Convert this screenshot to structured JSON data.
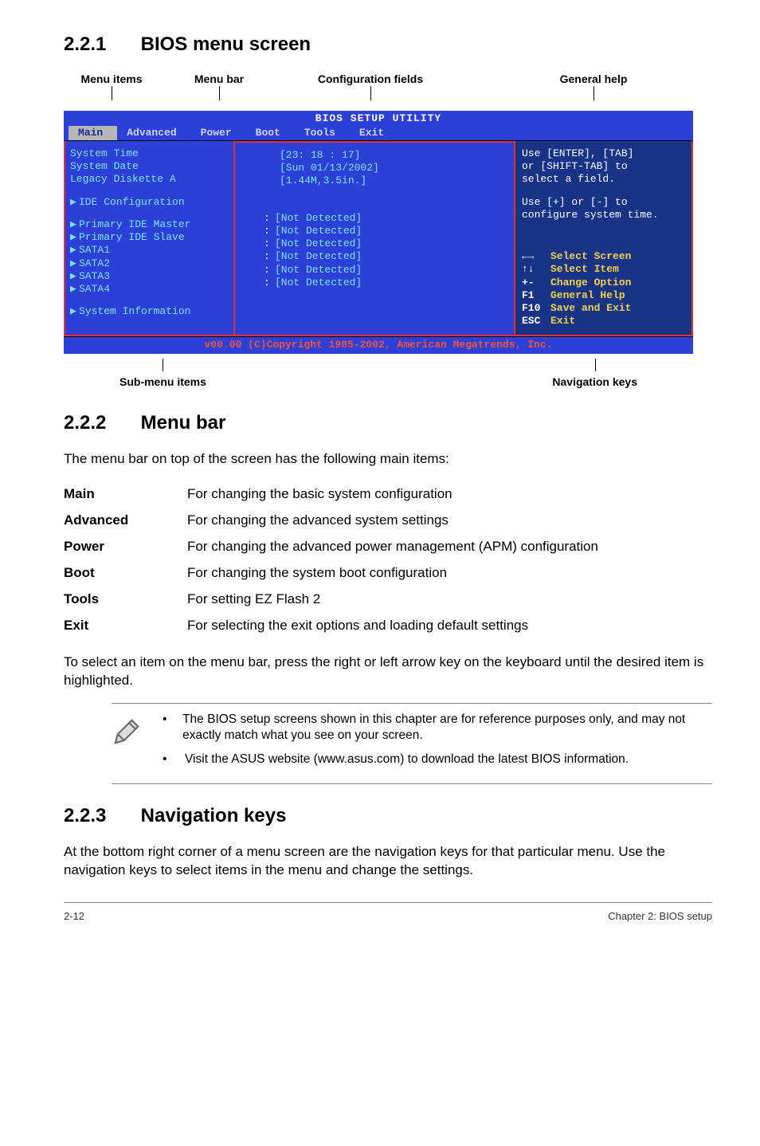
{
  "sections": {
    "s1": {
      "num": "2.2.1",
      "title": "BIOS menu screen"
    },
    "s2": {
      "num": "2.2.2",
      "title": "Menu bar"
    },
    "s3": {
      "num": "2.2.3",
      "title": "Navigation keys"
    }
  },
  "topLabels": {
    "menuItems": "Menu items",
    "menuBar": "Menu bar",
    "configFields": "Configuration fields",
    "generalHelp": "General help"
  },
  "bios": {
    "utilTitle": "BIOS SETUP UTILITY",
    "tabs": [
      "Main",
      "Advanced",
      "Power",
      "Boot",
      "Tools",
      "Exit"
    ],
    "left": {
      "sysTime": "System Time",
      "sysDate": "System Date",
      "legacy": "Legacy Diskette A",
      "ideConf": "IDE Configuration",
      "pMaster": "Primary IDE Master",
      "pSlave": "Primary IDE Slave",
      "sata1": "SATA1",
      "sata2": "SATA2",
      "sata3": "SATA3",
      "sata4": "SATA4",
      "sysInfo": "System Information"
    },
    "mid": {
      "time": "[23: 18 : 17]",
      "date": "[Sun 01/13/2002]",
      "disk": "[1.44M,3.5in.]",
      "nd": "[Not Detected]"
    },
    "right": {
      "hint1a": "Use [ENTER], [TAB]",
      "hint1b": "or [SHIFT-TAB] to",
      "hint1c": "select a field.",
      "hint2a": "Use [+] or [-] to",
      "hint2b": "configure system time.",
      "nav": [
        {
          "k": "←→",
          "d": "Select Screen"
        },
        {
          "k": "↑↓",
          "d": "Select Item"
        },
        {
          "k": "+-",
          "d": "Change Option"
        },
        {
          "k": "F1",
          "d": "General Help"
        },
        {
          "k": "F10",
          "d": "Save and Exit"
        },
        {
          "k": "ESC",
          "d": "Exit"
        }
      ]
    },
    "footer": "v00.00 (C)Copyright 1985-2002, American Megatrends, Inc."
  },
  "subLabels": {
    "submenu": "Sub-menu items",
    "navkeys": "Navigation keys"
  },
  "menuBarIntro": "The menu bar on top of the screen has the following main items:",
  "menuBarItems": [
    {
      "k": "Main",
      "d": "For changing the basic system configuration"
    },
    {
      "k": "Advanced",
      "d": "For changing the advanced system settings"
    },
    {
      "k": "Power",
      "d": "For changing the advanced power management (APM) configuration"
    },
    {
      "k": "Boot",
      "d": "For changing the system boot configuration"
    },
    {
      "k": "Tools",
      "d": "For setting EZ Flash 2"
    },
    {
      "k": "Exit",
      "d": "For selecting the exit options and loading default settings"
    }
  ],
  "menuBarNote": "To select an item on the menu bar, press the right or left arrow key on the keyboard until the desired item is highlighted.",
  "noteList": [
    "The BIOS setup screens shown in this chapter are for reference purposes only, and may not exactly match what you see on your screen.",
    "Visit the ASUS website (www.asus.com) to download the latest BIOS information."
  ],
  "navKeysPara": "At the bottom right corner of a menu screen are the navigation keys for that particular menu. Use the navigation keys to select items in the menu and change the settings.",
  "footer": {
    "left": "2-12",
    "right": "Chapter 2: BIOS setup"
  }
}
